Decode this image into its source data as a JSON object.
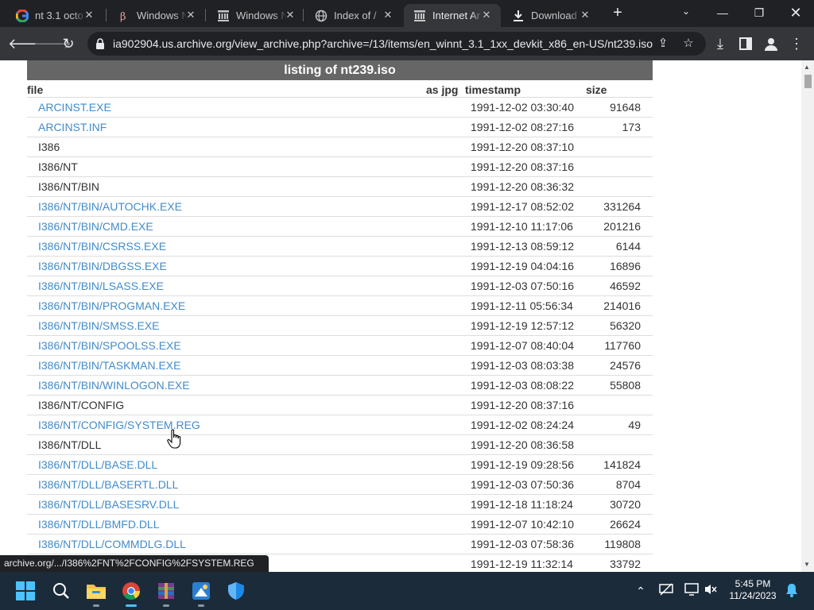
{
  "browser": {
    "tabs": [
      {
        "title": "nt 3.1 octo",
        "icon": "google-icon",
        "active": false
      },
      {
        "title": "Windows N",
        "icon": "betawiki-icon",
        "active": false
      },
      {
        "title": "Windows N",
        "icon": "archive-icon",
        "active": false
      },
      {
        "title": "Index of /",
        "icon": "globe-icon",
        "active": false
      },
      {
        "title": "Internet Ar",
        "icon": "archive-icon",
        "active": true
      },
      {
        "title": "Download",
        "icon": "download-icon",
        "active": false
      }
    ],
    "url": "ia902904.us.archive.org/view_archive.php?archive=/13/items/en_winnt_3.1_1xx_devkit_x86_en-US/nt239.iso",
    "status_bar_text": "archive.org/.../I386%2FNT%2FCONFIG%2FSYSTEM.REG",
    "colors": {
      "tabstrip": "#202124",
      "toolbar": "#35363a",
      "link": "#428bca",
      "header_bg": "#666666"
    }
  },
  "listing": {
    "title": "listing of nt239.iso",
    "columns": {
      "file": "file",
      "jpg": "as jpg",
      "timestamp": "timestamp",
      "size": "size"
    },
    "rows": [
      {
        "file": "ARCINST.EXE",
        "timestamp": "1991-12-02 03:30:40",
        "size": "91648",
        "link": true
      },
      {
        "file": "ARCINST.INF",
        "timestamp": "1991-12-02 08:27:16",
        "size": "173",
        "link": true
      },
      {
        "file": "I386",
        "timestamp": "1991-12-20 08:37:10",
        "size": "",
        "link": false
      },
      {
        "file": "I386/NT",
        "timestamp": "1991-12-20 08:37:16",
        "size": "",
        "link": false
      },
      {
        "file": "I386/NT/BIN",
        "timestamp": "1991-12-20 08:36:32",
        "size": "",
        "link": false
      },
      {
        "file": "I386/NT/BIN/AUTOCHK.EXE",
        "timestamp": "1991-12-17 08:52:02",
        "size": "331264",
        "link": true
      },
      {
        "file": "I386/NT/BIN/CMD.EXE",
        "timestamp": "1991-12-10 11:17:06",
        "size": "201216",
        "link": true
      },
      {
        "file": "I386/NT/BIN/CSRSS.EXE",
        "timestamp": "1991-12-13 08:59:12",
        "size": "6144",
        "link": true
      },
      {
        "file": "I386/NT/BIN/DBGSS.EXE",
        "timestamp": "1991-12-19 04:04:16",
        "size": "16896",
        "link": true
      },
      {
        "file": "I386/NT/BIN/LSASS.EXE",
        "timestamp": "1991-12-03 07:50:16",
        "size": "46592",
        "link": true
      },
      {
        "file": "I386/NT/BIN/PROGMAN.EXE",
        "timestamp": "1991-12-11 05:56:34",
        "size": "214016",
        "link": true
      },
      {
        "file": "I386/NT/BIN/SMSS.EXE",
        "timestamp": "1991-12-19 12:57:12",
        "size": "56320",
        "link": true
      },
      {
        "file": "I386/NT/BIN/SPOOLSS.EXE",
        "timestamp": "1991-12-07 08:40:04",
        "size": "117760",
        "link": true
      },
      {
        "file": "I386/NT/BIN/TASKMAN.EXE",
        "timestamp": "1991-12-03 08:03:38",
        "size": "24576",
        "link": true
      },
      {
        "file": "I386/NT/BIN/WINLOGON.EXE",
        "timestamp": "1991-12-03 08:08:22",
        "size": "55808",
        "link": true
      },
      {
        "file": "I386/NT/CONFIG",
        "timestamp": "1991-12-20 08:37:16",
        "size": "",
        "link": false
      },
      {
        "file": "I386/NT/CONFIG/SYSTEM.REG",
        "timestamp": "1991-12-02 08:24:24",
        "size": "49",
        "link": true
      },
      {
        "file": "I386/NT/DLL",
        "timestamp": "1991-12-20 08:36:58",
        "size": "",
        "link": false
      },
      {
        "file": "I386/NT/DLL/BASE.DLL",
        "timestamp": "1991-12-19 09:28:56",
        "size": "141824",
        "link": true
      },
      {
        "file": "I386/NT/DLL/BASERTL.DLL",
        "timestamp": "1991-12-03 07:50:36",
        "size": "8704",
        "link": true
      },
      {
        "file": "I386/NT/DLL/BASESRV.DLL",
        "timestamp": "1991-12-18 11:18:24",
        "size": "30720",
        "link": true
      },
      {
        "file": "I386/NT/DLL/BMFD.DLL",
        "timestamp": "1991-12-07 10:42:10",
        "size": "26624",
        "link": true
      },
      {
        "file": "I386/NT/DLL/COMMDLG.DLL",
        "timestamp": "1991-12-03 07:58:36",
        "size": "119808",
        "link": true
      },
      {
        "file": "",
        "timestamp": "1991-12-19 11:32:14",
        "size": "33792",
        "link": true
      }
    ]
  },
  "taskbar": {
    "apps": [
      {
        "name": "start-icon",
        "active": false
      },
      {
        "name": "search-icon",
        "active": false
      },
      {
        "name": "file-explorer-icon",
        "active": false
      },
      {
        "name": "chrome-icon",
        "active": true
      },
      {
        "name": "winrar-icon",
        "active": false
      },
      {
        "name": "paint-icon",
        "active": false
      },
      {
        "name": "defender-icon",
        "active": false
      }
    ],
    "time": "5:45 PM",
    "date": "11/24/2023"
  }
}
